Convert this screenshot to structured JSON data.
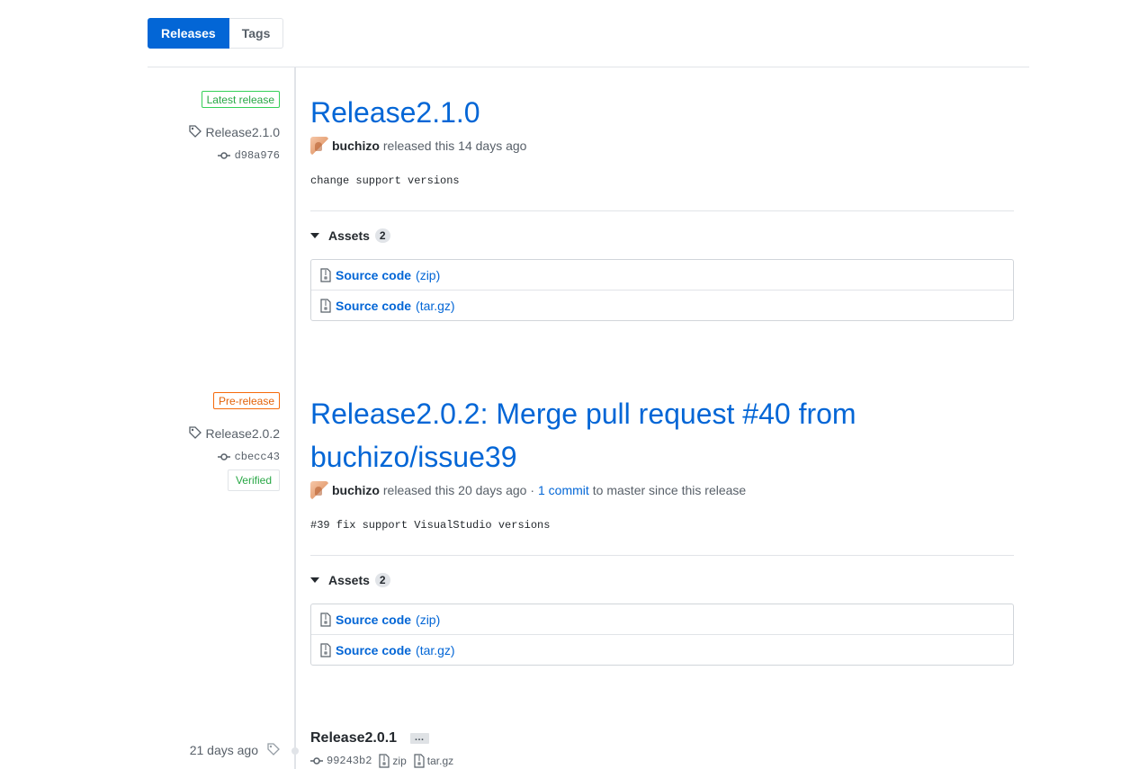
{
  "tabs": [
    {
      "label": "Releases",
      "active": true
    },
    {
      "label": "Tags",
      "active": false
    }
  ],
  "releases": [
    {
      "badge": "Latest release",
      "tag": "Release2.1.0",
      "commit": "d98a976",
      "title": "Release2.1.0",
      "author": "buchizo",
      "released_text": "released this 14 days ago",
      "description": "change support versions",
      "assets_label": "Assets",
      "assets_count": "2",
      "assets": [
        {
          "name": "Source code",
          "ext": "(zip)"
        },
        {
          "name": "Source code",
          "ext": "(tar.gz)"
        }
      ]
    },
    {
      "badge": "Pre-release",
      "tag": "Release2.0.2",
      "commit": "cbecc43",
      "verified": "Verified",
      "title": "Release2.0.2: Merge pull request #40 from buchizo/issue39",
      "author": "buchizo",
      "released_text": "released this 20 days ago ·",
      "commits_link": "1 commit",
      "since_text": "to master since this release",
      "description": "#39 fix support VisualStudio versions",
      "assets_label": "Assets",
      "assets_count": "2",
      "assets": [
        {
          "name": "Source code",
          "ext": "(zip)"
        },
        {
          "name": "Source code",
          "ext": "(tar.gz)"
        }
      ]
    }
  ],
  "tag_entry": {
    "age": "21 days ago",
    "title": "Release2.0.1",
    "ellipsis": "…",
    "commit": "99243b2",
    "zip": "zip",
    "targz": "tar.gz"
  },
  "colors": {
    "accent": "#0366d6",
    "latest": "#28a745",
    "pre": "#e36209"
  },
  "icons": [
    "tag-icon",
    "commit-icon",
    "file-zip-icon",
    "triangle-down-icon"
  ]
}
